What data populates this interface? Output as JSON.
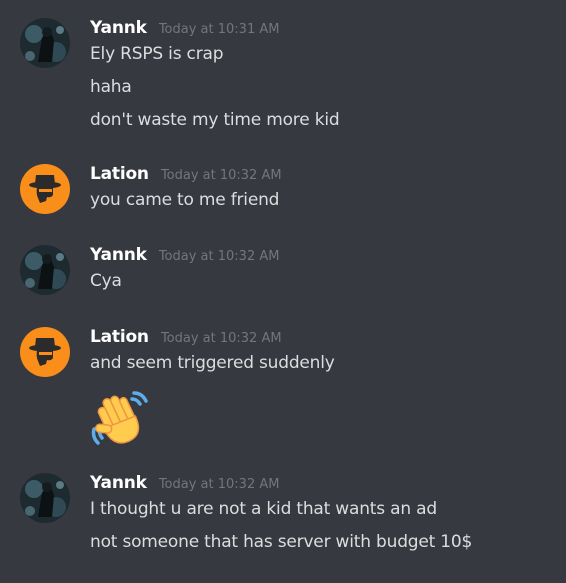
{
  "colors": {
    "background": "#36393f",
    "username": "#ffffff",
    "message_text": "#dcddde",
    "timestamp": "#72767d",
    "lation_avatar_bg": "#f98e1b"
  },
  "groups": [
    {
      "author": "Yannk",
      "timestamp": "Today at 10:31 AM",
      "avatar_icon": "dark-figure-avatar",
      "messages": [
        "Ely RSPS is crap",
        "haha",
        "don't waste my time more kid"
      ]
    },
    {
      "author": "Lation",
      "timestamp": "Today at 10:32 AM",
      "avatar_icon": "hat-silhouette-avatar",
      "messages": [
        "you came to me friend"
      ]
    },
    {
      "author": "Yannk",
      "timestamp": "Today at 10:32 AM",
      "avatar_icon": "dark-figure-avatar",
      "messages": [
        "Cya"
      ]
    },
    {
      "author": "Lation",
      "timestamp": "Today at 10:32 AM",
      "avatar_icon": "hat-silhouette-avatar",
      "messages": [
        "and seem triggered suddenly"
      ],
      "emoji": "waving-hand-emoji"
    },
    {
      "author": "Yannk",
      "timestamp": "Today at 10:32 AM",
      "avatar_icon": "dark-figure-avatar",
      "messages": [
        "I thought u are not a kid that wants an ad",
        "not someone that has server with budget 10$"
      ]
    }
  ]
}
